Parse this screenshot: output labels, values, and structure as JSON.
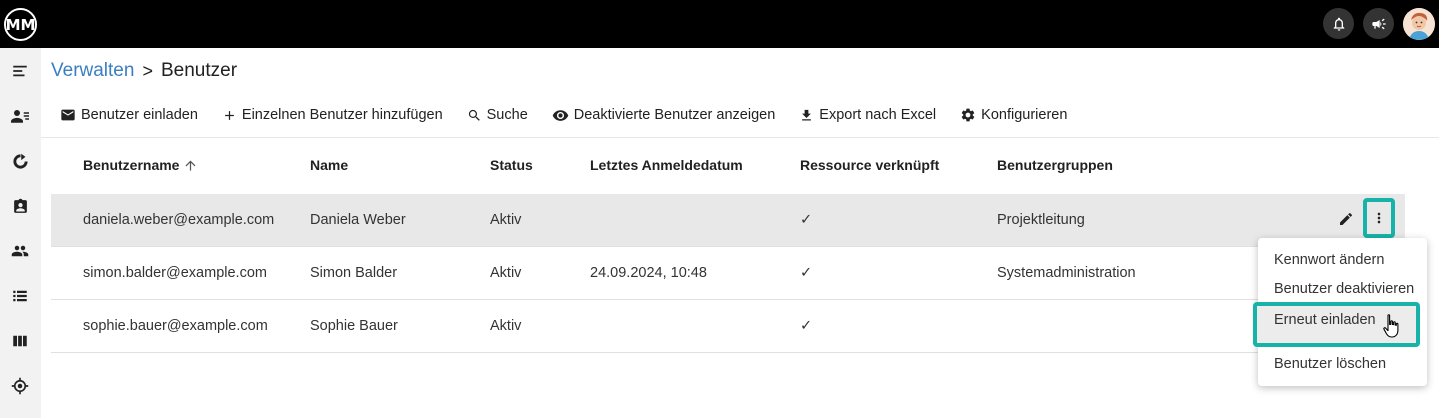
{
  "app": {
    "logo_text": "MM"
  },
  "breadcrumb": {
    "parent": "Verwalten",
    "separator": ">",
    "current": "Benutzer"
  },
  "toolbar": {
    "invite": "Benutzer einladen",
    "add_single": "Einzelnen Benutzer hinzufügen",
    "search": "Suche",
    "show_deactivated": "Deaktivierte Benutzer anzeigen",
    "export": "Export nach Excel",
    "configure": "Konfigurieren"
  },
  "table": {
    "headers": {
      "username": "Benutzername",
      "name": "Name",
      "status": "Status",
      "last_login": "Letztes Anmeldedatum",
      "resource": "Ressource verknüpft",
      "groups": "Benutzergruppen"
    },
    "rows": [
      {
        "username": "daniela.weber@example.com",
        "name": "Daniela Weber",
        "status": "Aktiv",
        "last_login": "",
        "resource": "✓",
        "groups": "Projektleitung"
      },
      {
        "username": "simon.balder@example.com",
        "name": "Simon Balder",
        "status": "Aktiv",
        "last_login": "24.09.2024, 10:48",
        "resource": "✓",
        "groups": "Systemadministration"
      },
      {
        "username": "sophie.bauer@example.com",
        "name": "Sophie Bauer",
        "status": "Aktiv",
        "last_login": "",
        "resource": "✓",
        "groups": ""
      }
    ]
  },
  "context_menu": {
    "change_password": "Kennwort ändern",
    "deactivate": "Benutzer deaktivieren",
    "reinvite": "Erneut einladen",
    "delete": "Benutzer löschen"
  },
  "colors": {
    "accent": "#3a7fc1",
    "highlight": "#17b3a8",
    "topbar": "#000000"
  },
  "icons": [
    "bell-icon",
    "megaphone-icon",
    "menu-icon",
    "user-list-icon",
    "refresh-icon",
    "badge-icon",
    "users-icon",
    "list-icon",
    "columns-icon",
    "target-icon",
    "mail-icon",
    "plus-icon",
    "search-icon",
    "eye-icon",
    "download-icon",
    "gear-icon",
    "arrow-up-icon",
    "pencil-icon",
    "more-vert-icon",
    "hand-cursor-icon"
  ]
}
